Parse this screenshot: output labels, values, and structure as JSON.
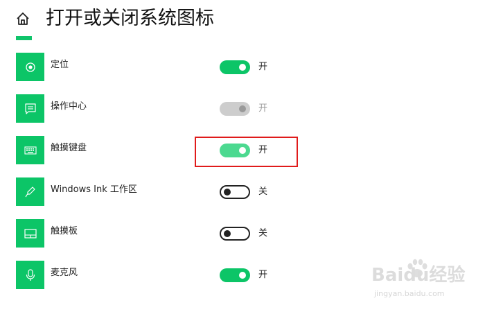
{
  "header": {
    "title": "打开或关闭系统图标",
    "home_icon": "home-icon"
  },
  "settings": [
    {
      "key": "location",
      "label": "定位",
      "icon": "location-icon",
      "state": "开",
      "toggle": "on"
    },
    {
      "key": "action_center",
      "label": "操作中心",
      "icon": "action-center-icon",
      "state": "开",
      "toggle": "disabled"
    },
    {
      "key": "touch_keyboard",
      "label": "触摸键盘",
      "icon": "keyboard-icon",
      "state": "开",
      "toggle": "on-highlighted"
    },
    {
      "key": "windows_ink",
      "label": "Windows Ink 工作区",
      "icon": "pen-icon",
      "state": "关",
      "toggle": "off"
    },
    {
      "key": "touchpad",
      "label": "触摸板",
      "icon": "touchpad-icon",
      "state": "关",
      "toggle": "off"
    },
    {
      "key": "microphone",
      "label": "麦克风",
      "icon": "microphone-icon",
      "state": "开",
      "toggle": "on"
    }
  ],
  "watermark": {
    "main": "Baidu经验",
    "sub": "jingyan.baidu.com"
  },
  "colors": {
    "accent": "#0cc567",
    "highlight": "#e01b1b"
  }
}
